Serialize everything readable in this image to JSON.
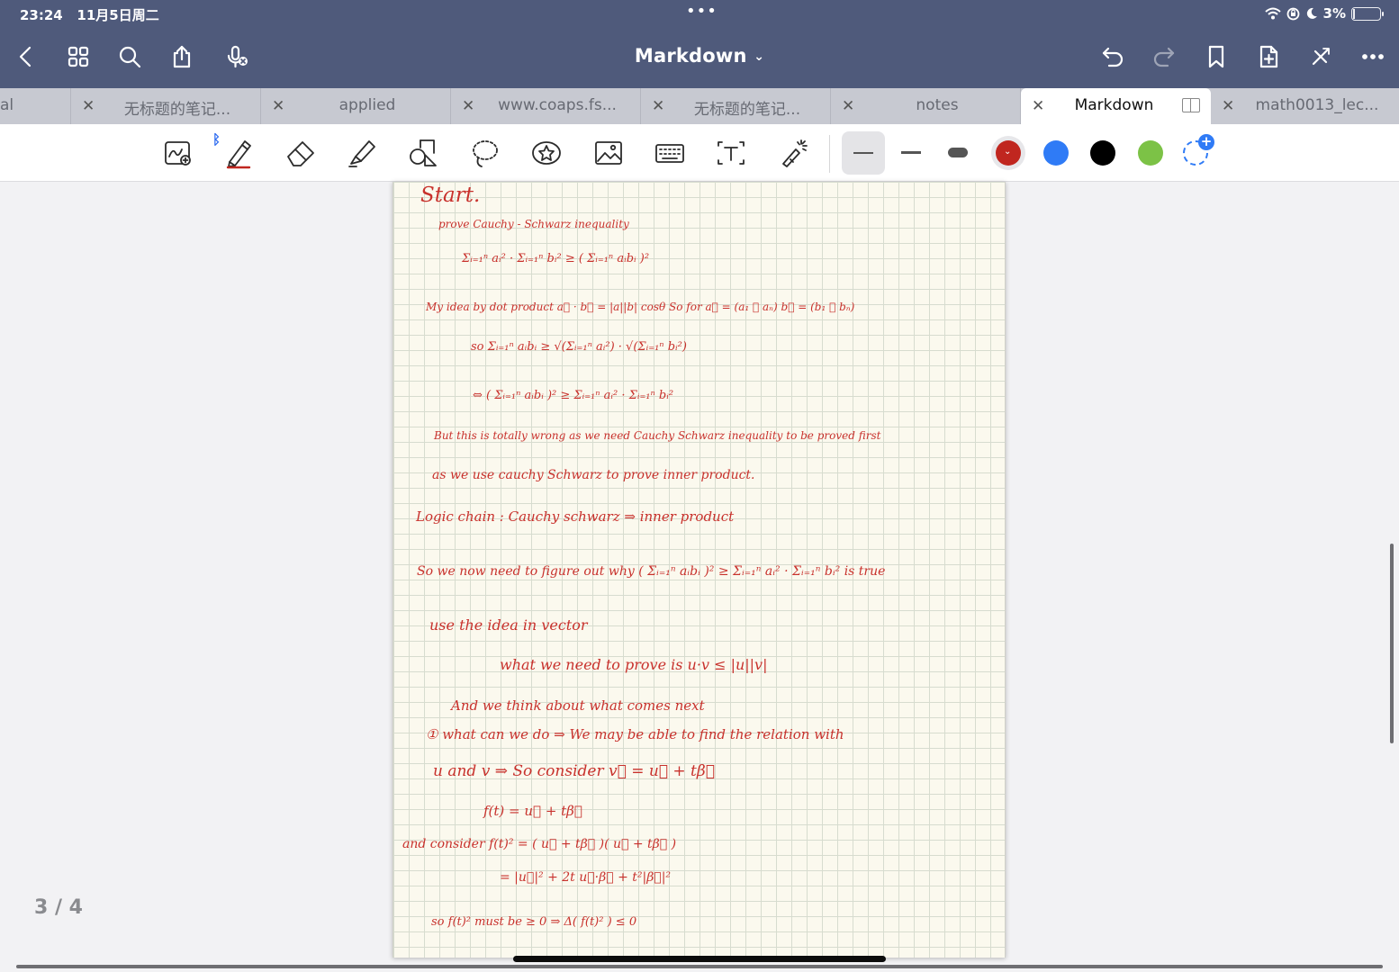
{
  "status": {
    "time": "23:24",
    "date": "11月5日周二",
    "battery": "3%",
    "battery_fraction": 0.03
  },
  "header": {
    "title": "Markdown",
    "title_chevron": "⌄"
  },
  "tabs": [
    {
      "label": "al",
      "close": ""
    },
    {
      "label": "无标题的笔记...",
      "close": "✕"
    },
    {
      "label": "applied",
      "close": "✕"
    },
    {
      "label": "www.coaps.fs...",
      "close": "✕"
    },
    {
      "label": "无标题的笔记...",
      "close": "✕"
    },
    {
      "label": "notes",
      "close": "✕"
    },
    {
      "label": "Markdown",
      "close": "✕",
      "active": true
    },
    {
      "label": "math0013_lec...",
      "close": "✕"
    }
  ],
  "colors": {
    "topbar": "#4f5a7b",
    "ink": "#c8312c",
    "swatches": [
      "#c0261f",
      "#2f7bf6",
      "#000000",
      "#7cc246"
    ]
  },
  "icons": {
    "header_left": [
      "back-icon",
      "grid-icon",
      "search-icon",
      "share-icon",
      "microphone-off-icon"
    ],
    "header_right": [
      "undo-icon",
      "redo-icon",
      "bookmark-icon",
      "add-page-icon",
      "close-tools-icon",
      "more-icon"
    ],
    "tools": [
      "zoom-window-icon",
      "pen-icon",
      "eraser-icon",
      "highlighter-icon",
      "shapes-icon",
      "lasso-icon",
      "sticker-icon",
      "image-icon",
      "keyboard-icon",
      "text-box-icon",
      "laser-pointer-icon"
    ]
  },
  "page": {
    "counter": "3 / 4"
  },
  "notes": [
    "Start.",
    "prove  Cauchy - Schwarz  inequality",
    "Σᵢ₌₁ⁿ aᵢ² · Σᵢ₌₁ⁿ bᵢ²  ≥  ( Σᵢ₌₁ⁿ aᵢbᵢ )²",
    "My idea by dot product   a⃗ · b⃗ = |a||b| cosθ   So for  a⃗ = (a₁ ⋮ aₙ)   b⃗ = (b₁ ⋮ bₙ)",
    "so   Σᵢ₌₁ⁿ aᵢbᵢ  ≥  √(Σᵢ₌₁ⁿ aᵢ²) · √(Σᵢ₌₁ⁿ bᵢ²)",
    "⇔  ( Σᵢ₌₁ⁿ aᵢbᵢ )²  ≥  Σᵢ₌₁ⁿ aᵢ² · Σᵢ₌₁ⁿ bᵢ²",
    "But this is totally wrong   as we need Cauchy Schwarz inequality to be proved first",
    "as  we use  cauchy Schwarz  to  prove  inner  product.",
    "Logic chain :  Cauchy  schwarz  ⇒ inner  product",
    "So  we  now  need to  figure out  why  ( Σᵢ₌₁ⁿ aᵢbᵢ )²  ≥  Σᵢ₌₁ⁿ aᵢ² · Σᵢ₌₁ⁿ bᵢ²  is true",
    "use  the idea  in  vector",
    "what  we  need to  prove is    u·v ≤ |u||v|",
    "And we  think about  what comes  next",
    "① what  can we do  ⇒  We  may be  able  to  find  the relation  with",
    "u  and  v  ⇒  So   consider   v⃗ = u⃗ + tβ⃗",
    "f(t) = u⃗ + tβ⃗",
    "and consider  f(t)² = ( u⃗ + tβ⃗ )( u⃗ + tβ⃗ )",
    "= |u⃗|² + 2t u⃗·β⃗ + t²|β⃗|²",
    "so   f(t)² must  be  ≥ 0    ⇒   Δ( f(t)² ) ≤ 0"
  ]
}
